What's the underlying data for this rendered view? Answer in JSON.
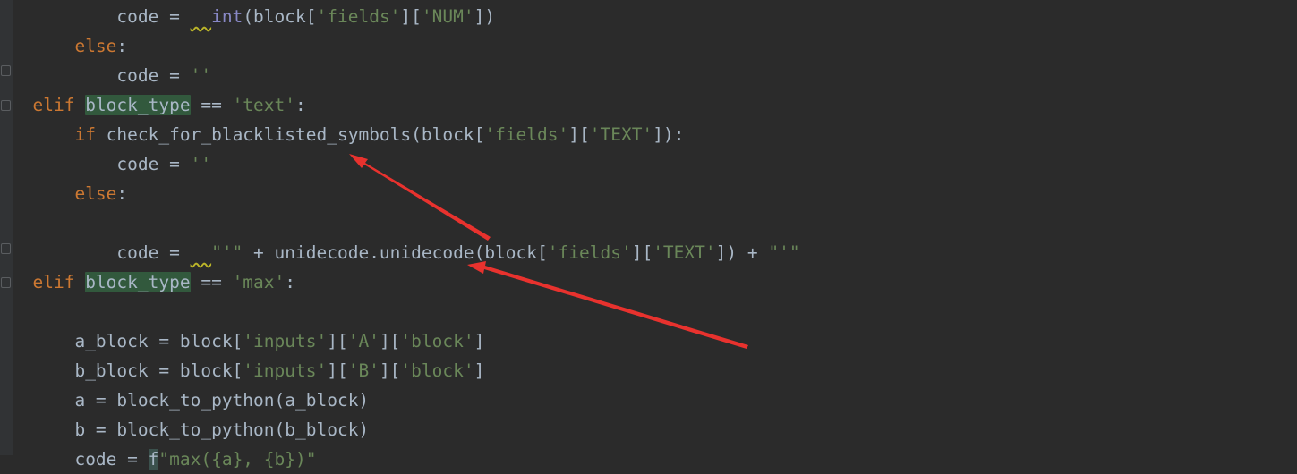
{
  "editor": {
    "lines": [
      {
        "indent": "          ",
        "segments": [
          {
            "t": "code = "
          },
          {
            "t": "  ",
            "c": "warn"
          },
          {
            "t": "int",
            "c": "builtin"
          },
          {
            "t": "(block["
          },
          {
            "t": "'fields'",
            "c": "str"
          },
          {
            "t": "]["
          },
          {
            "t": "'NUM'",
            "c": "str"
          },
          {
            "t": "])"
          }
        ]
      },
      {
        "indent": "      ",
        "segments": [
          {
            "t": "else",
            "c": "kw"
          },
          {
            "t": ":"
          }
        ]
      },
      {
        "indent": "          ",
        "segments": [
          {
            "t": "code = "
          },
          {
            "t": "''",
            "c": "str"
          }
        ]
      },
      {
        "indent": "  ",
        "segments": [
          {
            "t": "elif ",
            "c": "kw"
          },
          {
            "t": "block_type",
            "c": "hl"
          },
          {
            "t": " == "
          },
          {
            "t": "'text'",
            "c": "str"
          },
          {
            "t": ":"
          }
        ]
      },
      {
        "indent": "      ",
        "segments": [
          {
            "t": "if ",
            "c": "kw"
          },
          {
            "t": "check_for_blacklisted_symbols(block["
          },
          {
            "t": "'fields'",
            "c": "str"
          },
          {
            "t": "]["
          },
          {
            "t": "'TEXT'",
            "c": "str"
          },
          {
            "t": "]):"
          }
        ]
      },
      {
        "indent": "          ",
        "segments": [
          {
            "t": "code = "
          },
          {
            "t": "''",
            "c": "str"
          }
        ]
      },
      {
        "indent": "      ",
        "segments": [
          {
            "t": "else",
            "c": "kw"
          },
          {
            "t": ":"
          }
        ]
      },
      {
        "indent": "",
        "segments": []
      },
      {
        "indent": "          ",
        "segments": [
          {
            "t": "code = "
          },
          {
            "t": "  ",
            "c": "warn"
          },
          {
            "t": "\"'\"",
            "c": "str"
          },
          {
            "t": " + unidecode.unidecode(block["
          },
          {
            "t": "'fields'",
            "c": "str"
          },
          {
            "t": "]["
          },
          {
            "t": "'TEXT'",
            "c": "str"
          },
          {
            "t": "]) + "
          },
          {
            "t": "\"'\"",
            "c": "str"
          }
        ]
      },
      {
        "indent": "  ",
        "segments": [
          {
            "t": "elif ",
            "c": "kw"
          },
          {
            "t": "block_type",
            "c": "hl"
          },
          {
            "t": " == "
          },
          {
            "t": "'max'",
            "c": "str"
          },
          {
            "t": ":"
          }
        ]
      },
      {
        "indent": "",
        "segments": []
      },
      {
        "indent": "      ",
        "segments": [
          {
            "t": "a_block = block["
          },
          {
            "t": "'inputs'",
            "c": "str"
          },
          {
            "t": "]["
          },
          {
            "t": "'A'",
            "c": "str"
          },
          {
            "t": "]["
          },
          {
            "t": "'block'",
            "c": "str"
          },
          {
            "t": "]"
          }
        ]
      },
      {
        "indent": "      ",
        "segments": [
          {
            "t": "b_block = block["
          },
          {
            "t": "'inputs'",
            "c": "str"
          },
          {
            "t": "]["
          },
          {
            "t": "'B'",
            "c": "str"
          },
          {
            "t": "]["
          },
          {
            "t": "'block'",
            "c": "str"
          },
          {
            "t": "]"
          }
        ]
      },
      {
        "indent": "      ",
        "segments": [
          {
            "t": "a = block_to_python(a_block)"
          }
        ]
      },
      {
        "indent": "      ",
        "segments": [
          {
            "t": "b = block_to_python(b_block)"
          }
        ]
      },
      {
        "indent": "      ",
        "segments": [
          {
            "t": "code = "
          },
          {
            "t": "f",
            "c": "hl-soft"
          },
          {
            "t": "\"max({a}, {b})\"",
            "c": "str"
          }
        ]
      }
    ]
  },
  "colors": {
    "background": "#2b2b2b",
    "keyword": "#cc7832",
    "string": "#6a8759",
    "builtin": "#8888c6",
    "text": "#a9b7c6",
    "annotation_arrow": "#e8322e"
  }
}
